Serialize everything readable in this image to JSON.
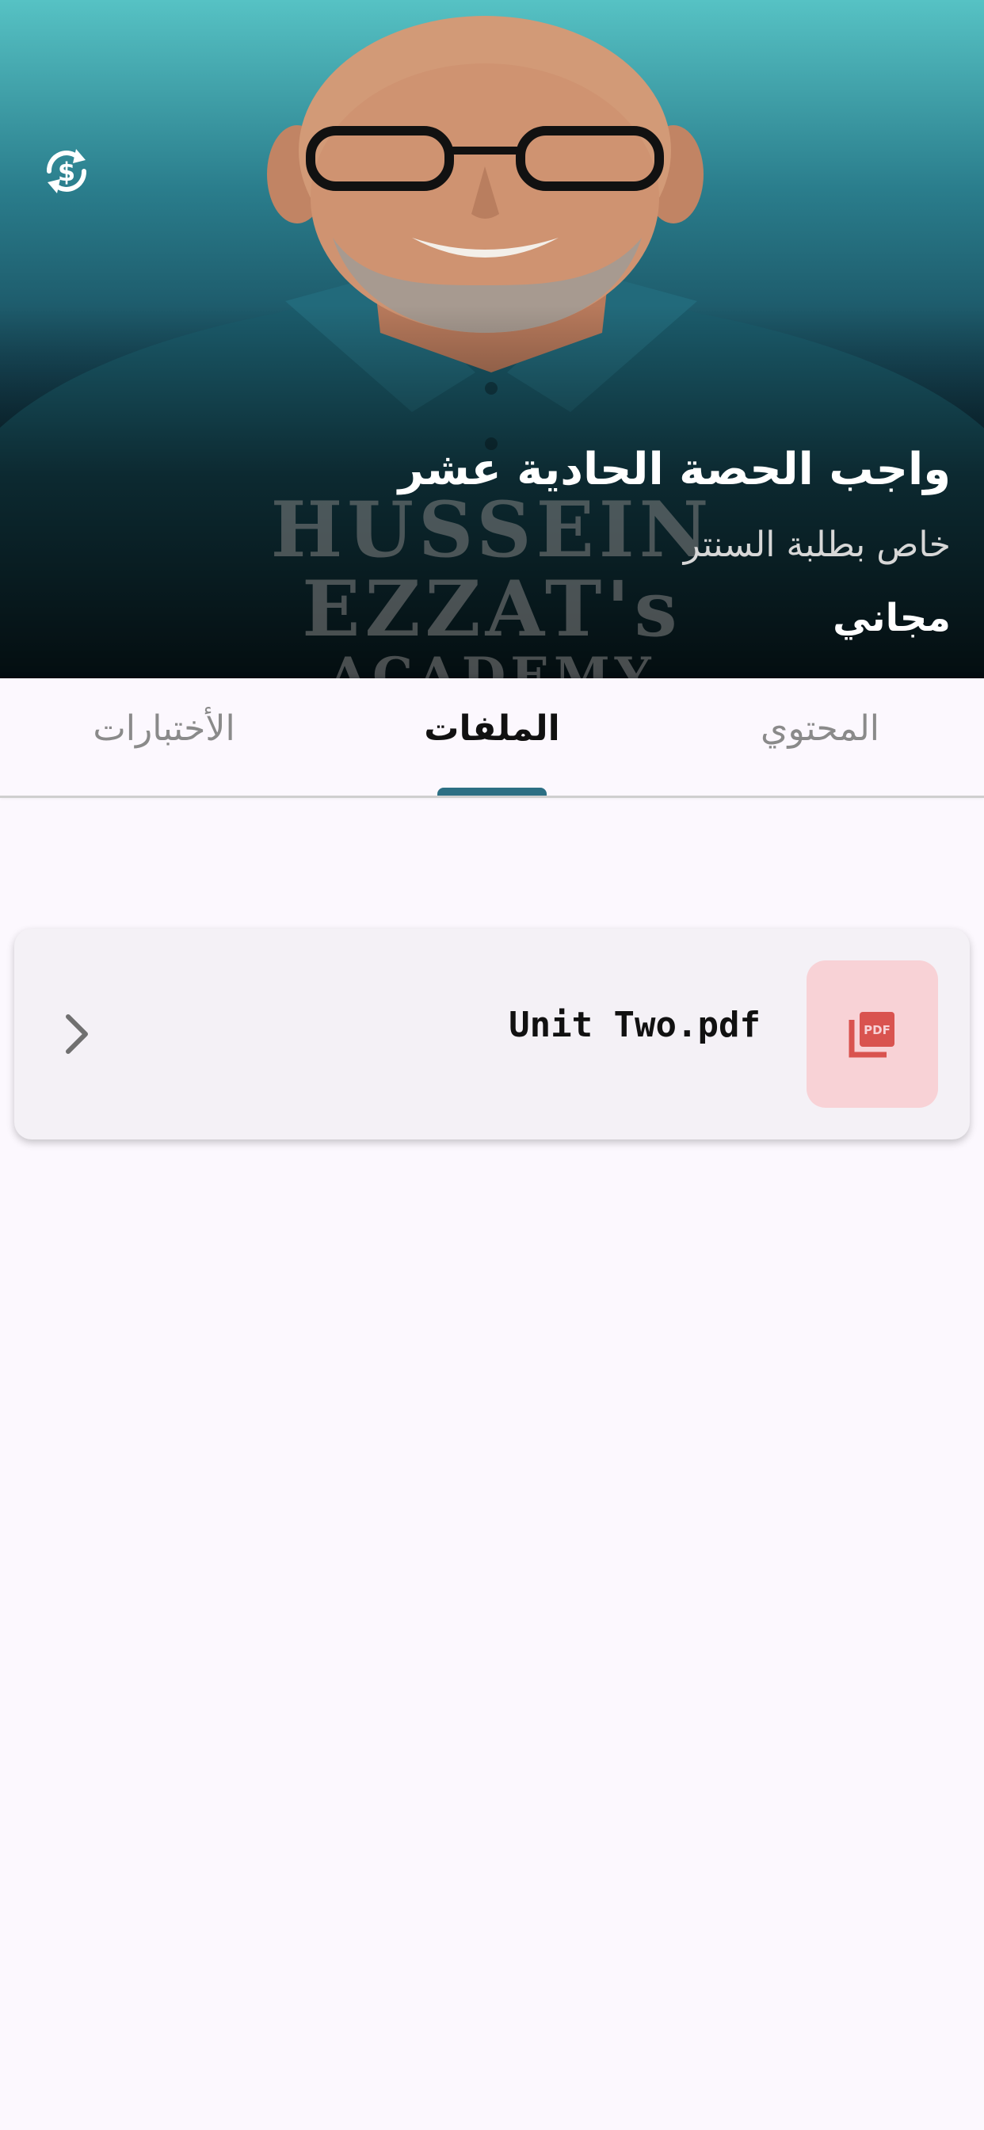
{
  "hero": {
    "title": "واجب الحصة الحادية عشر",
    "subtitle": "خاص بطلبة السنتر",
    "price": "مجاني",
    "watermark_line1": "HUSSEIN",
    "watermark_line2": "EZZAT's",
    "watermark_line3": "ACADEMY",
    "currency_icon": "currency-exchange-icon"
  },
  "tabs": {
    "content": "المحتوي",
    "files": "الملفات",
    "exams": "الأختبارات",
    "active": "files",
    "indicator_color": "#2c6f84"
  },
  "files": [
    {
      "name": "Unit Two.pdf",
      "icon": "pdf-icon",
      "icon_color": "#d9534f",
      "tile_color": "#f8d2d6"
    }
  ]
}
